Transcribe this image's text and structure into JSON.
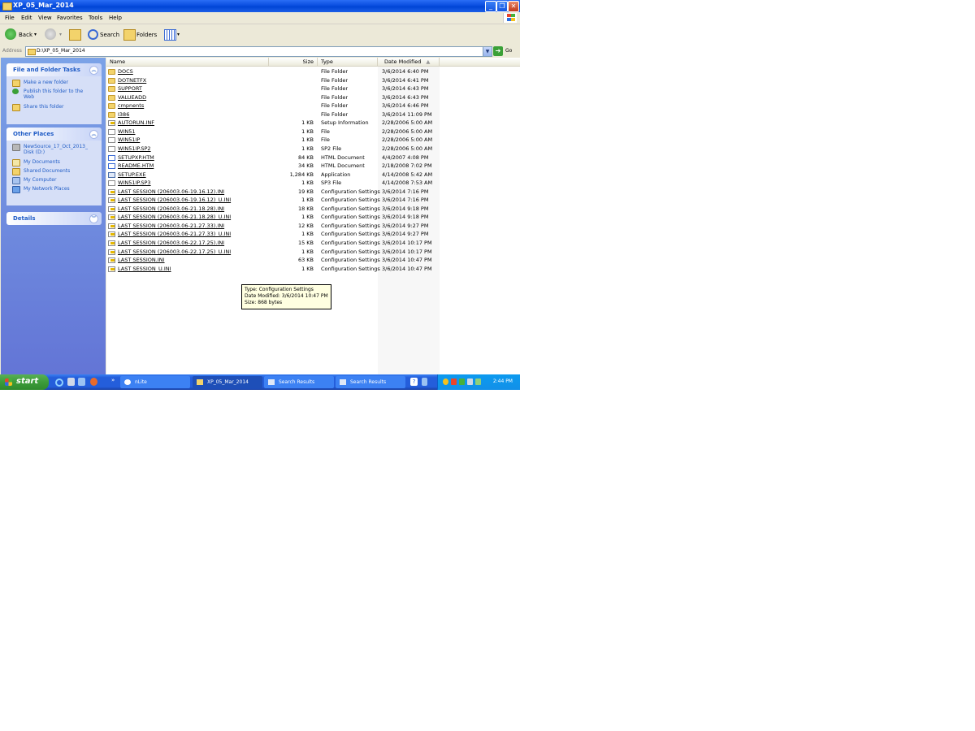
{
  "window": {
    "title": "XP_05_Mar_2014"
  },
  "menu": [
    "File",
    "Edit",
    "View",
    "Favorites",
    "Tools",
    "Help"
  ],
  "toolbar": {
    "back": "Back",
    "search": "Search",
    "folders": "Folders"
  },
  "address": {
    "label": "Address",
    "value": "D:\\XP_05_Mar_2014",
    "go": "Go"
  },
  "tasks": {
    "title": "File and Folder Tasks",
    "items": [
      "Make a new folder",
      "Publish this folder to the Web",
      "Share this folder"
    ]
  },
  "other_places": {
    "title": "Other Places",
    "items": [
      "NewSource_17_Oct_2013_ Disk (D:)",
      "My Documents",
      "Shared Documents",
      "My Computer",
      "My Network Places"
    ]
  },
  "details": {
    "title": "Details"
  },
  "columns": {
    "name": "Name",
    "size": "Size",
    "type": "Type",
    "date": "Date Modified"
  },
  "files": [
    {
      "name": "DOCS",
      "size": "",
      "type": "File Folder",
      "date": "3/6/2014 6:40 PM",
      "icon": "folder"
    },
    {
      "name": "DOTNETFX",
      "size": "",
      "type": "File Folder",
      "date": "3/6/2014 6:41 PM",
      "icon": "folder"
    },
    {
      "name": "SUPPORT",
      "size": "",
      "type": "File Folder",
      "date": "3/6/2014 6:43 PM",
      "icon": "folder"
    },
    {
      "name": "VALUEADD",
      "size": "",
      "type": "File Folder",
      "date": "3/6/2014 6:43 PM",
      "icon": "folder"
    },
    {
      "name": "cmpnents",
      "size": "",
      "type": "File Folder",
      "date": "3/6/2014 6:46 PM",
      "icon": "folder"
    },
    {
      "name": "I386",
      "size": "",
      "type": "File Folder",
      "date": "3/6/2014 11:09 PM",
      "icon": "folder"
    },
    {
      "name": "AUTORUN.INF",
      "size": "1 KB",
      "type": "Setup Information",
      "date": "2/28/2006 5:00 AM",
      "icon": "ini"
    },
    {
      "name": "WIN51",
      "size": "1 KB",
      "type": "File",
      "date": "2/28/2006 5:00 AM",
      "icon": "file"
    },
    {
      "name": "WIN51IP",
      "size": "1 KB",
      "type": "File",
      "date": "2/28/2006 5:00 AM",
      "icon": "file"
    },
    {
      "name": "WIN51IP.SP2",
      "size": "1 KB",
      "type": "SP2 File",
      "date": "2/28/2006 5:00 AM",
      "icon": "file"
    },
    {
      "name": "SETUPXP.HTM",
      "size": "84 KB",
      "type": "HTML Document",
      "date": "4/4/2007 4:08 PM",
      "icon": "html"
    },
    {
      "name": "README.HTM",
      "size": "34 KB",
      "type": "HTML Document",
      "date": "2/18/2008 7:02 PM",
      "icon": "html"
    },
    {
      "name": "SETUP.EXE",
      "size": "1,284 KB",
      "type": "Application",
      "date": "4/14/2008 5:42 AM",
      "icon": "exe"
    },
    {
      "name": "WIN51IP.SP3",
      "size": "1 KB",
      "type": "SP3 File",
      "date": "4/14/2008 7:53 AM",
      "icon": "file"
    },
    {
      "name": "LAST SESSION (206003.06-19.16.12).INI",
      "size": "19 KB",
      "type": "Configuration Settings",
      "date": "3/6/2014 7:16 PM",
      "icon": "ini"
    },
    {
      "name": "LAST SESSION (206003.06-19.16.12)_U.INI",
      "size": "1 KB",
      "type": "Configuration Settings",
      "date": "3/6/2014 7:16 PM",
      "icon": "ini"
    },
    {
      "name": "LAST SESSION (206003.06-21.18.28).INI",
      "size": "18 KB",
      "type": "Configuration Settings",
      "date": "3/6/2014 9:18 PM",
      "icon": "ini"
    },
    {
      "name": "LAST SESSION (206003.06-21.18.28)_U.INI",
      "size": "1 KB",
      "type": "Configuration Settings",
      "date": "3/6/2014 9:18 PM",
      "icon": "ini"
    },
    {
      "name": "LAST SESSION (206003.06-21.27.33).INI",
      "size": "12 KB",
      "type": "Configuration Settings",
      "date": "3/6/2014 9:27 PM",
      "icon": "ini"
    },
    {
      "name": "LAST SESSION (206003.06-21.27.33)_U.INI",
      "size": "1 KB",
      "type": "Configuration Settings",
      "date": "3/6/2014 9:27 PM",
      "icon": "ini"
    },
    {
      "name": "LAST SESSION (206003.06-22.17.25).INI",
      "size": "15 KB",
      "type": "Configuration Settings",
      "date": "3/6/2014 10:17 PM",
      "icon": "ini"
    },
    {
      "name": "LAST SESSION (206003.06-22.17.25)_U.INI",
      "size": "1 KB",
      "type": "Configuration Settings",
      "date": "3/6/2014 10:17 PM",
      "icon": "ini"
    },
    {
      "name": "LAST SESSION.INI",
      "size": "63 KB",
      "type": "Configuration Settings",
      "date": "3/6/2014 10:47 PM",
      "icon": "ini"
    },
    {
      "name": "LAST SESSION_U.INI",
      "size": "1 KB",
      "type": "Configuration Settings",
      "date": "3/6/2014 10:47 PM",
      "icon": "ini"
    }
  ],
  "tooltip": {
    "line1": "Type: Configuration Settings",
    "line2": "Date Modified: 3/6/2014 10:47 PM",
    "line3": "Size: 868 bytes"
  },
  "taskbar": {
    "start": "start",
    "items": [
      "nLite",
      "XP_05_Mar_2014",
      "Search Results",
      "Search Results"
    ],
    "clock": "2:44 PM"
  },
  "colors": {
    "title_bar": "#0a4ee0",
    "task_pane": "#6f8fe0",
    "start_button": "#3c9c3a",
    "taskbar": "#245edb"
  }
}
